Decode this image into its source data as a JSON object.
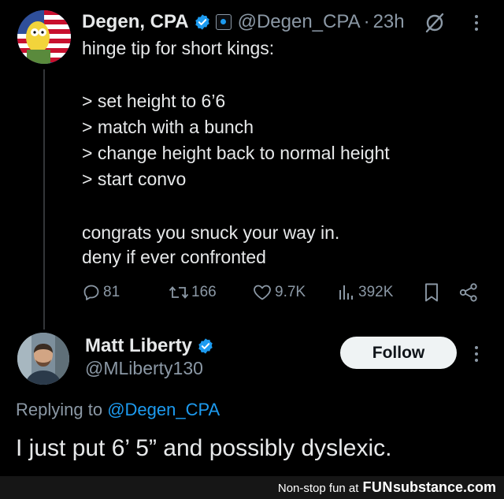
{
  "tweet": {
    "author_name": "Degen, CPA",
    "handle": "@Degen_CPA",
    "separator": "·",
    "time": "23h",
    "lines": [
      "hinge tip for short kings:",
      "> set height to 6’6",
      "> match with a bunch",
      "> change height back to normal height",
      "> start convo",
      "congrats you snuck your way in.",
      "deny if ever confronted"
    ],
    "stats": {
      "replies": "81",
      "retweets": "166",
      "likes": "9.7K",
      "views": "392K"
    }
  },
  "reply": {
    "author_name": "Matt Liberty",
    "handle": "@MLiberty130",
    "follow_label": "Follow",
    "replying_prefix": "Replying to",
    "replying_mention": "@Degen_CPA",
    "text": "I just put 6’ 5” and possibly dyslexic."
  },
  "watermark": {
    "tagline": "Non-stop fun at",
    "brand_fun": "FUN",
    "brand_substance": "substance",
    "brand_com": ".com"
  },
  "colors": {
    "background": "#000000",
    "text": "#e7e9ea",
    "secondary": "#8b98a5",
    "accent": "#1d9bf0",
    "follow_bg": "#eff3f4"
  },
  "icons": [
    "verified-badge-icon",
    "affiliate-badge-icon",
    "grok-icon",
    "more-icon",
    "reply-icon",
    "retweet-icon",
    "like-icon",
    "views-icon",
    "bookmark-icon",
    "share-icon"
  ]
}
